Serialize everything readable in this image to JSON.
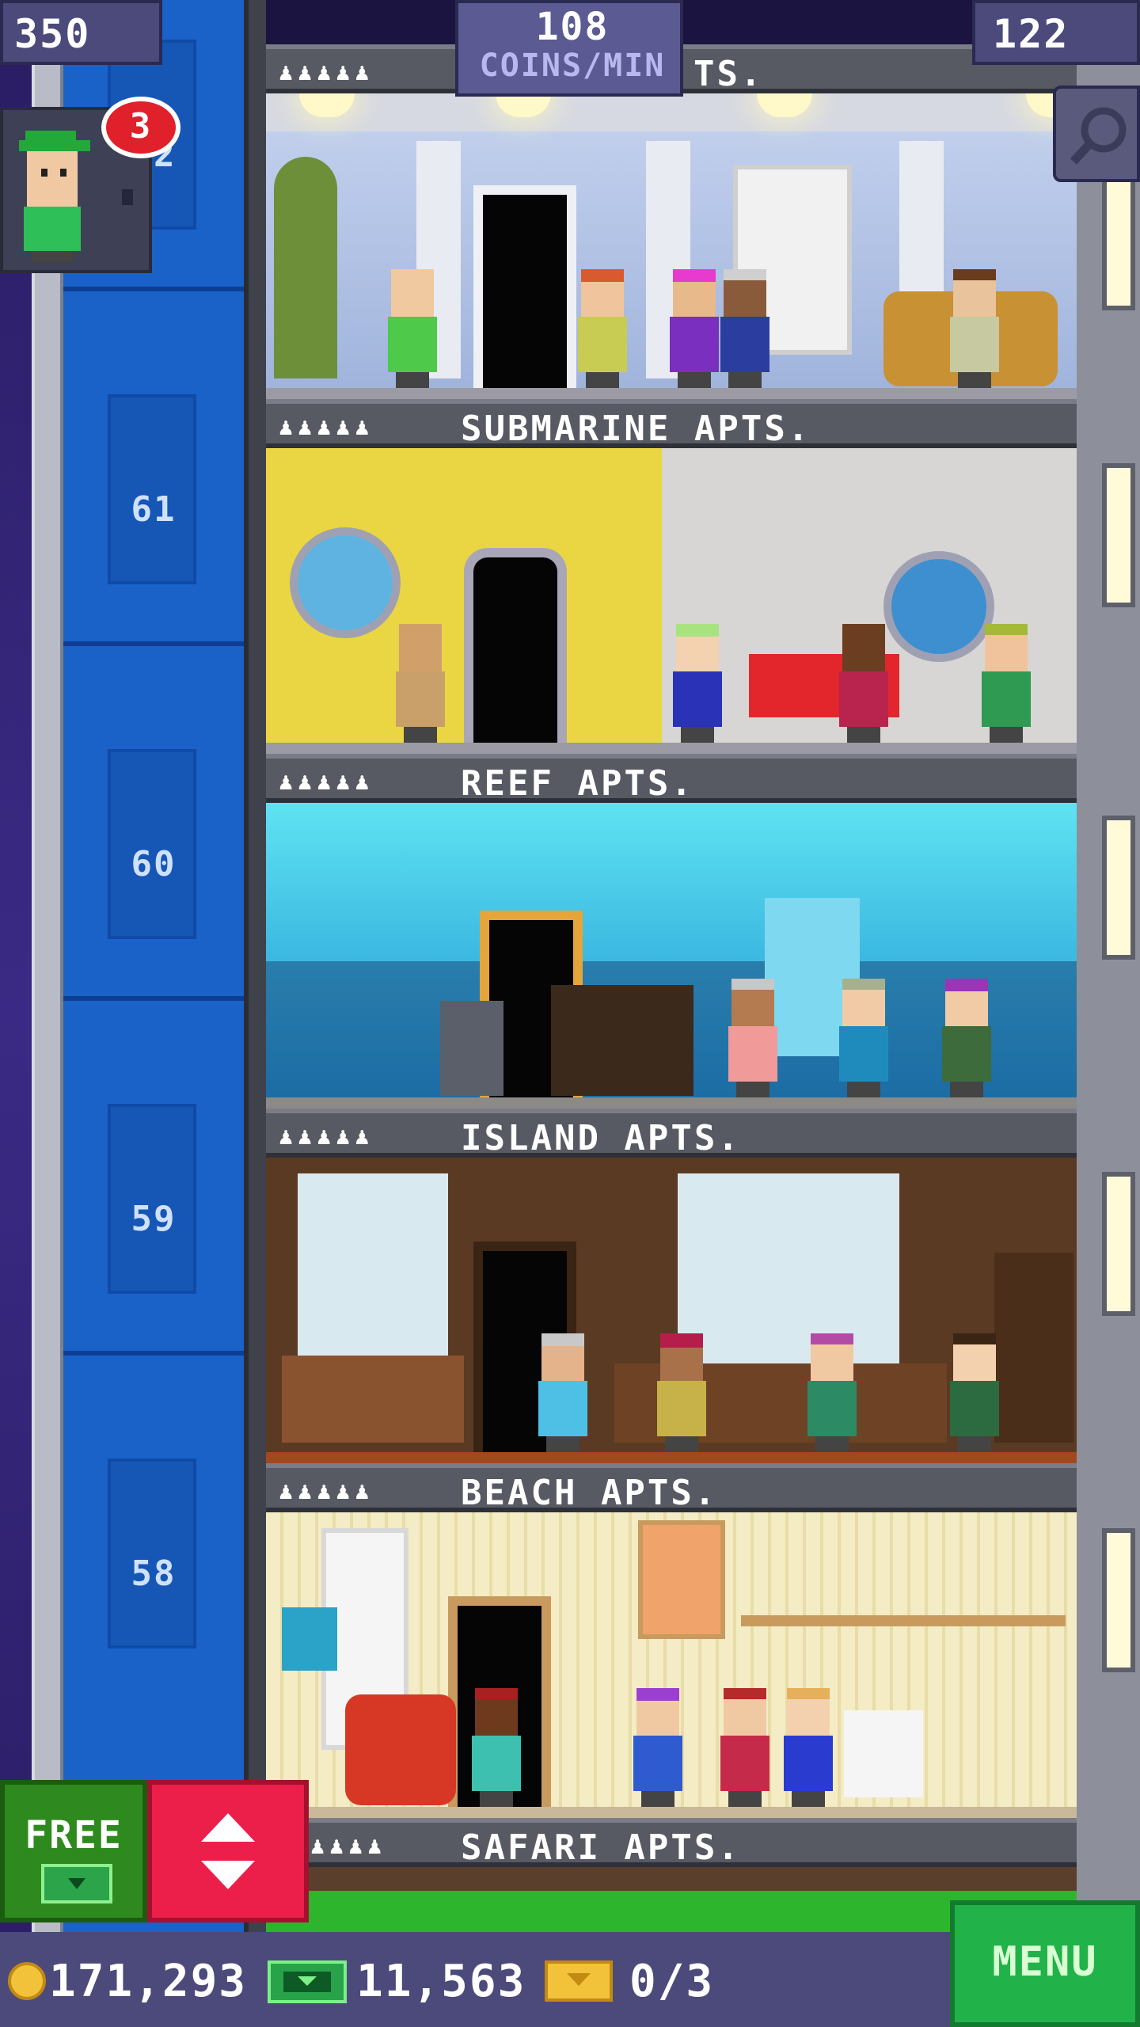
{
  "hud": {
    "population": "350",
    "coin_rate_value": "108",
    "coin_rate_unit": "COINS/MIN",
    "floor_count": "122"
  },
  "visitor": {
    "badge_count": "3"
  },
  "elevator": {
    "floor_numbers": [
      "62",
      "61",
      "60",
      "59",
      "58"
    ]
  },
  "floors": [
    {
      "name": "TS.",
      "occupancy_icons": "♟♟♟♟♟"
    },
    {
      "name": "SUBMARINE APTS.",
      "occupancy_icons": "♟♟♟♟♟"
    },
    {
      "name": "REEF APTS.",
      "occupancy_icons": "♟♟♟♟♟"
    },
    {
      "name": "ISLAND APTS.",
      "occupancy_icons": "♟♟♟♟♟"
    },
    {
      "name": "BEACH APTS.",
      "occupancy_icons": "♟♟♟♟♟"
    },
    {
      "name": "SAFARI APTS.",
      "occupancy_icons": "♟♟♟♟"
    }
  ],
  "controls": {
    "free_label": "FREE",
    "menu_label": "MENU"
  },
  "currency": {
    "coins": "171,293",
    "bux": "11,563",
    "tickets": "0/3"
  },
  "colors": {
    "elevator_shaft": "#1a62c8",
    "elevator_button": "#ec1f4b",
    "free_button": "#2e8a1e",
    "menu_button": "#22b24a",
    "hud_panel": "#4b4a7a"
  }
}
